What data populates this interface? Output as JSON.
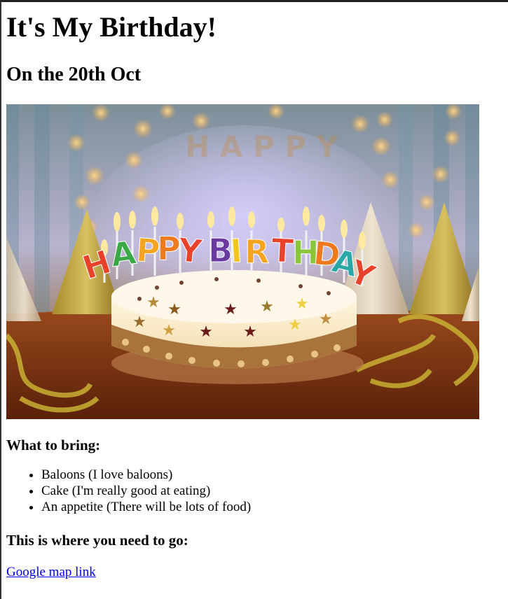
{
  "heading": "It's My Birthday!",
  "subheading": "On the 20th Oct",
  "image": {
    "subject": "birthday-cake-with-happy-birthday-candles",
    "candle_text": "HAPPY BIRTHDAY"
  },
  "bring_section": {
    "title": "What to bring:",
    "items": [
      "Baloons (I love baloons)",
      "Cake (I'm really good at eating)",
      "An appetite (There will be lots of food)"
    ]
  },
  "location_section": {
    "title": "This is where you need to go:",
    "link_text": "Google map link"
  },
  "colors": {
    "link": "#0000ee",
    "text": "#000000",
    "background": "#ffffff"
  }
}
